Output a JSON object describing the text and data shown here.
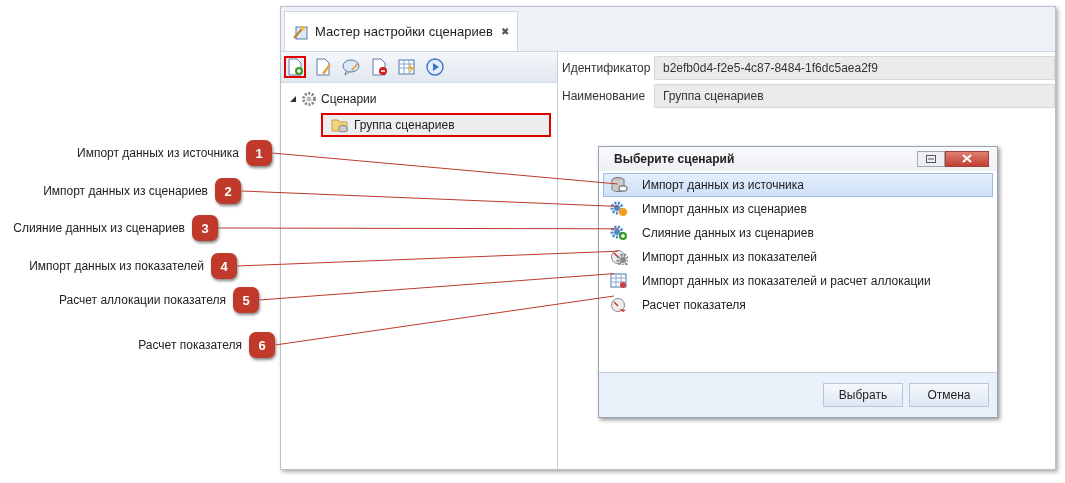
{
  "window": {
    "tab": {
      "title": "Мастер настройки сценариев",
      "close": "✖"
    }
  },
  "toolbar": [
    {
      "kind": "new",
      "highlighted": true
    },
    {
      "kind": "edit",
      "highlighted": false
    },
    {
      "kind": "comment",
      "highlighted": false
    },
    {
      "kind": "delete",
      "highlighted": false
    },
    {
      "kind": "table",
      "highlighted": false
    },
    {
      "kind": "play",
      "highlighted": false
    }
  ],
  "tree": [
    {
      "label": "Сценарии",
      "expanded": true,
      "children": [
        {
          "label": "Группа сценариев",
          "highlighted": true
        }
      ]
    }
  ],
  "fields": [
    {
      "label": "Идентификатор",
      "value": "b2efb0d4-f2e5-4c87-8484-1f6dc5aea2f9"
    },
    {
      "label": "Наименование",
      "value": "Группа сценариев"
    }
  ],
  "dialog": {
    "title": "Выберите сценарий",
    "items": [
      {
        "label": "Импорт данных из источника",
        "kind": "database",
        "selected": true
      },
      {
        "label": "Импорт данных из сценариев",
        "kind": "gear-orange",
        "selected": false
      },
      {
        "label": "Слияние данных из сценариев",
        "kind": "gear-plus",
        "selected": false
      },
      {
        "label": "Импорт данных из показателей",
        "kind": "gauge-gear",
        "selected": false
      },
      {
        "label": "Импорт данных из показателей и расчет аллокации",
        "kind": "grid",
        "selected": false
      },
      {
        "label": "Расчет показателя",
        "kind": "gauge",
        "selected": false
      }
    ],
    "buttons": [
      "Выбрать",
      "Отмена"
    ]
  },
  "callouts": [
    {
      "number": "1",
      "label": "Импорт данных из источника"
    },
    {
      "number": "2",
      "label": "Импорт данных из сценариев"
    },
    {
      "number": "3",
      "label": "Слияние данных из сценариев"
    },
    {
      "number": "4",
      "label": "Импорт данных из показателей"
    },
    {
      "number": "5",
      "label": "Расчет аллокации показателя"
    },
    {
      "number": "6",
      "label": "Расчет показателя"
    }
  ]
}
